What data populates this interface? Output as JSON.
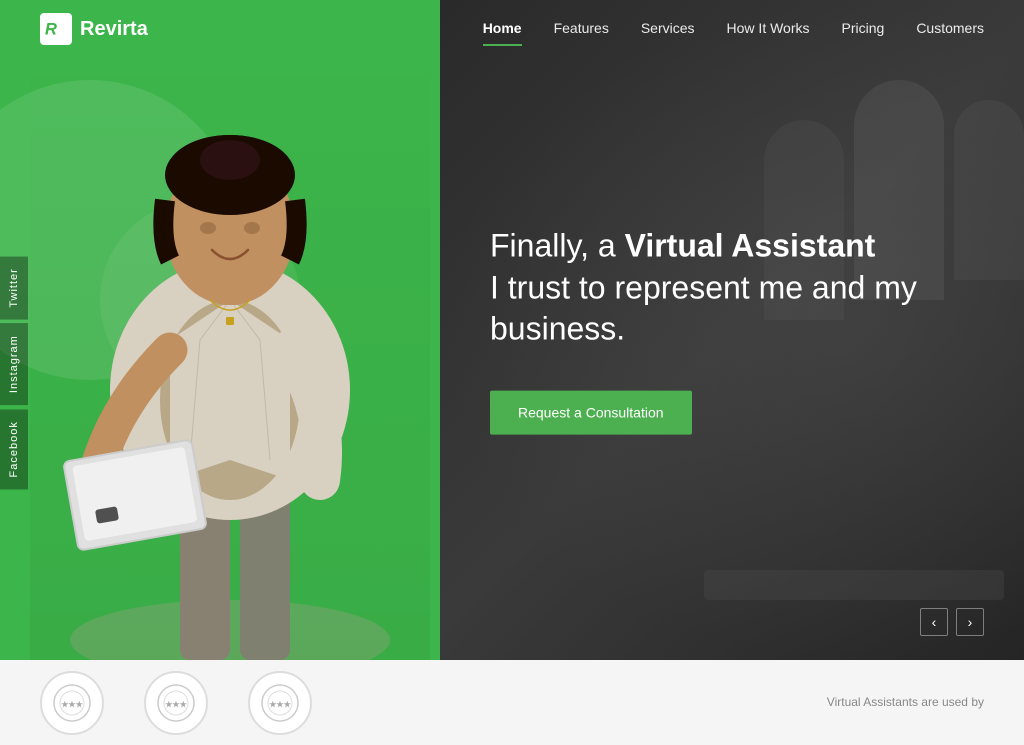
{
  "brand": {
    "name": "Revirta",
    "logo_letter": "R"
  },
  "nav": {
    "items": [
      {
        "label": "Home",
        "active": true
      },
      {
        "label": "Features",
        "active": false
      },
      {
        "label": "Services",
        "active": false
      },
      {
        "label": "How It Works",
        "active": false
      },
      {
        "label": "Pricing",
        "active": false
      },
      {
        "label": "Customers",
        "active": false
      }
    ]
  },
  "hero": {
    "headline_part1": "Finally, a ",
    "headline_bold": "Virtual Assistant",
    "headline_part2": "I trust to represent me and my business.",
    "cta_label": "Request a Consultation"
  },
  "social": [
    {
      "label": "Facebook"
    },
    {
      "label": "Instagram"
    },
    {
      "label": "Twitter"
    }
  ],
  "slider": {
    "prev_label": "‹",
    "next_label": "›"
  },
  "bottom": {
    "badges": [
      "badge1",
      "badge2",
      "badge3"
    ],
    "tagline": "Virtual Assistants are used by"
  },
  "colors": {
    "green": "#3cb54a",
    "dark": "#2a2a2a"
  }
}
